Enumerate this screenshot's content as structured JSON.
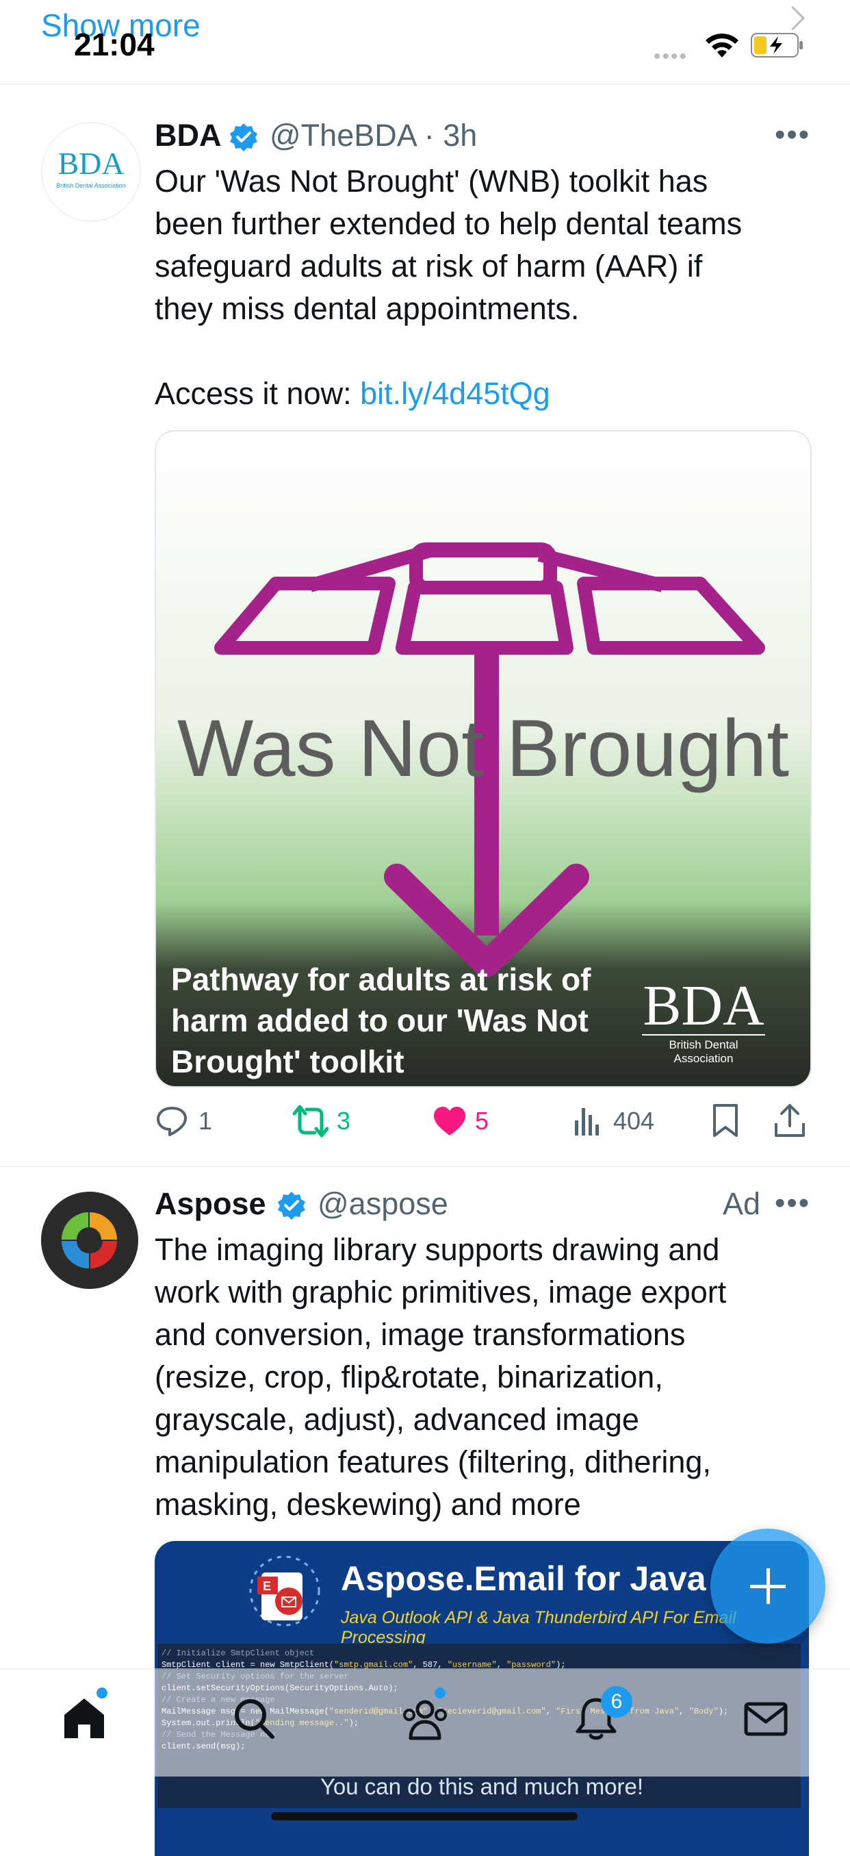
{
  "status_bar": {
    "show_more": "Show more",
    "time": "21:04",
    "signal": "••••"
  },
  "tweets": [
    {
      "name": "BDA",
      "handle": "@TheBDA",
      "time": "· 3h",
      "text": "Our 'Was Not Brought' (WNB) toolkit has\nbeen further extended to help dental teams\nsafeguard adults at risk of harm (AAR) if\nthey miss dental appointments.\n\nAccess it now: ",
      "link": "bit.ly/4d45tQg",
      "avatar_text": "BDA",
      "avatar_sub": "British Dental Association",
      "image": {
        "headline": "Was Not Brought",
        "caption": "Pathway for adults at risk of harm added to our 'Was Not Brought' toolkit",
        "logo": "BDA",
        "logo_sub": "British Dental Association"
      },
      "actions": {
        "replies": "1",
        "retweets": "3",
        "likes": "5",
        "views": "404"
      }
    },
    {
      "name": "Aspose",
      "handle": "@aspose",
      "ad_label": "Ad",
      "text": "The imaging library supports drawing and\nwork with graphic primitives, image export\nand conversion, image transformations\n(resize, crop, flip&rotate, binarization,\ngrayscale, adjust), advanced image\nmanipulation features (filtering, dithering,\nmasking, deskewing) and more",
      "image": {
        "title": "Aspose.Email for Java",
        "subtitle": "Java Outlook API & Java Thunderbird API For Email Processing",
        "bottom_text": "You can do this and much more!"
      }
    }
  ],
  "nav": {
    "notifications_badge": "6"
  },
  "colors": {
    "accent": "#1d9bf0",
    "like": "#f91880",
    "retweet": "#00ba7c",
    "wnb_magenta": "#a5228a"
  }
}
